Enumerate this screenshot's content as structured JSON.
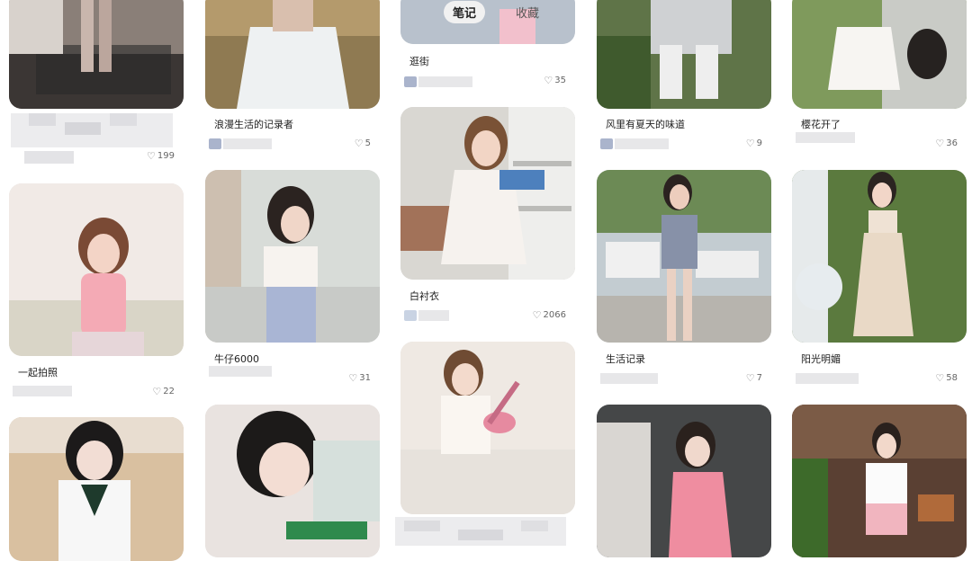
{
  "tabs": [
    {
      "label": "笔记",
      "active": true
    },
    {
      "label": "收藏",
      "active": false
    }
  ],
  "cards": {
    "c1a": {
      "title": "",
      "likes": "199"
    },
    "c1b": {
      "title": "一起拍照",
      "likes": "22"
    },
    "c2a": {
      "title": "浪漫生活的记录者",
      "likes": "5"
    },
    "c2b": {
      "title": "牛仔6000",
      "likes": "31"
    },
    "c3a": {
      "title": "逛街",
      "likes": "35"
    },
    "c3b": {
      "title": "白衬衣",
      "likes": "2066"
    },
    "c4a": {
      "title": "风里有夏天的味道",
      "likes": "9"
    },
    "c4b": {
      "title": "生活记录",
      "likes": "7"
    },
    "c5a": {
      "title": "樱花开了",
      "likes": "36"
    },
    "c5b": {
      "title": "阳光明媚",
      "likes": "58"
    }
  },
  "icons": {
    "like": "heart-icon"
  }
}
